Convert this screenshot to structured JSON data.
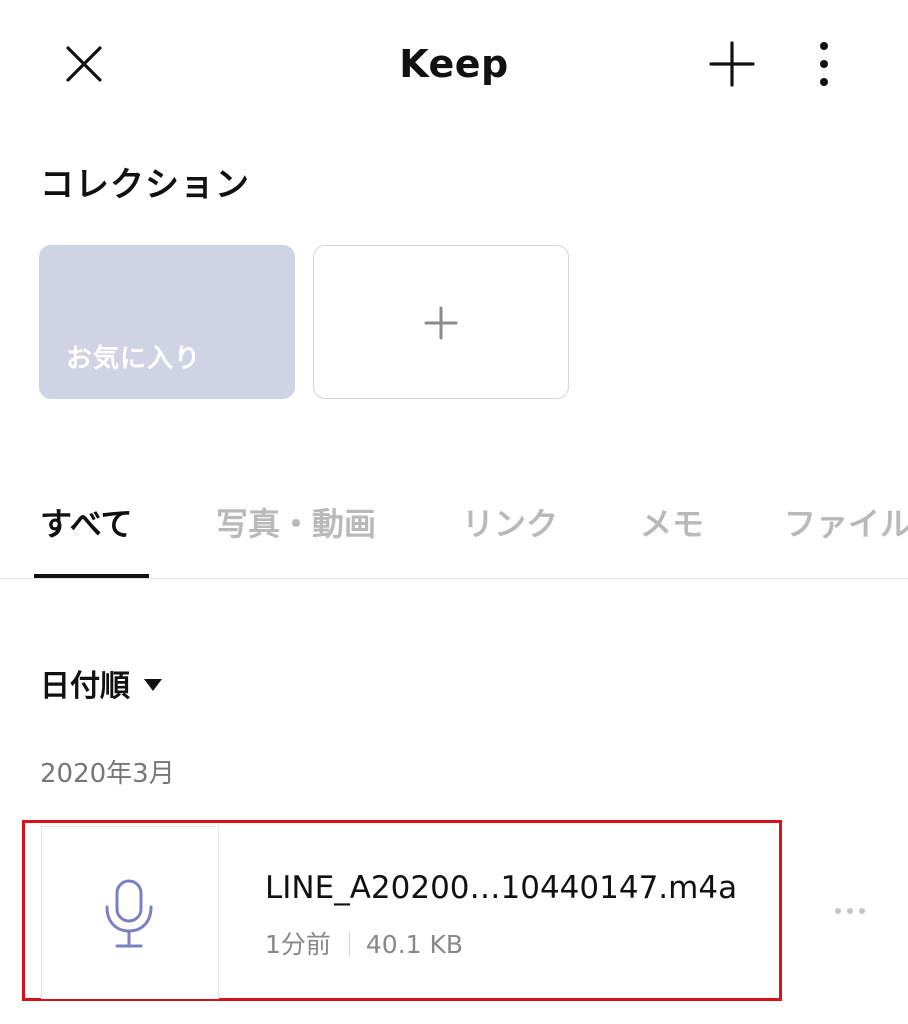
{
  "header": {
    "title": "Keep"
  },
  "collection": {
    "title": "コレクション",
    "favorites_label": "お気に入り",
    "favorites_color": "#cfd3e4"
  },
  "tabs": [
    {
      "label": "すべて",
      "active": true
    },
    {
      "label": "写真・動画",
      "active": false
    },
    {
      "label": "リンク",
      "active": false
    },
    {
      "label": "メモ",
      "active": false
    },
    {
      "label": "ファイル",
      "active": false
    }
  ],
  "sort": {
    "label": "日付順"
  },
  "groups": [
    {
      "date_label": "2020年3月",
      "items": [
        {
          "icon": "microphone-icon",
          "icon_color": "#7b80c4",
          "name": "LINE_A20200…10440147.m4a",
          "time": "1分前",
          "size": "40.1 KB"
        }
      ]
    }
  ],
  "highlight_color": "#d9121a"
}
